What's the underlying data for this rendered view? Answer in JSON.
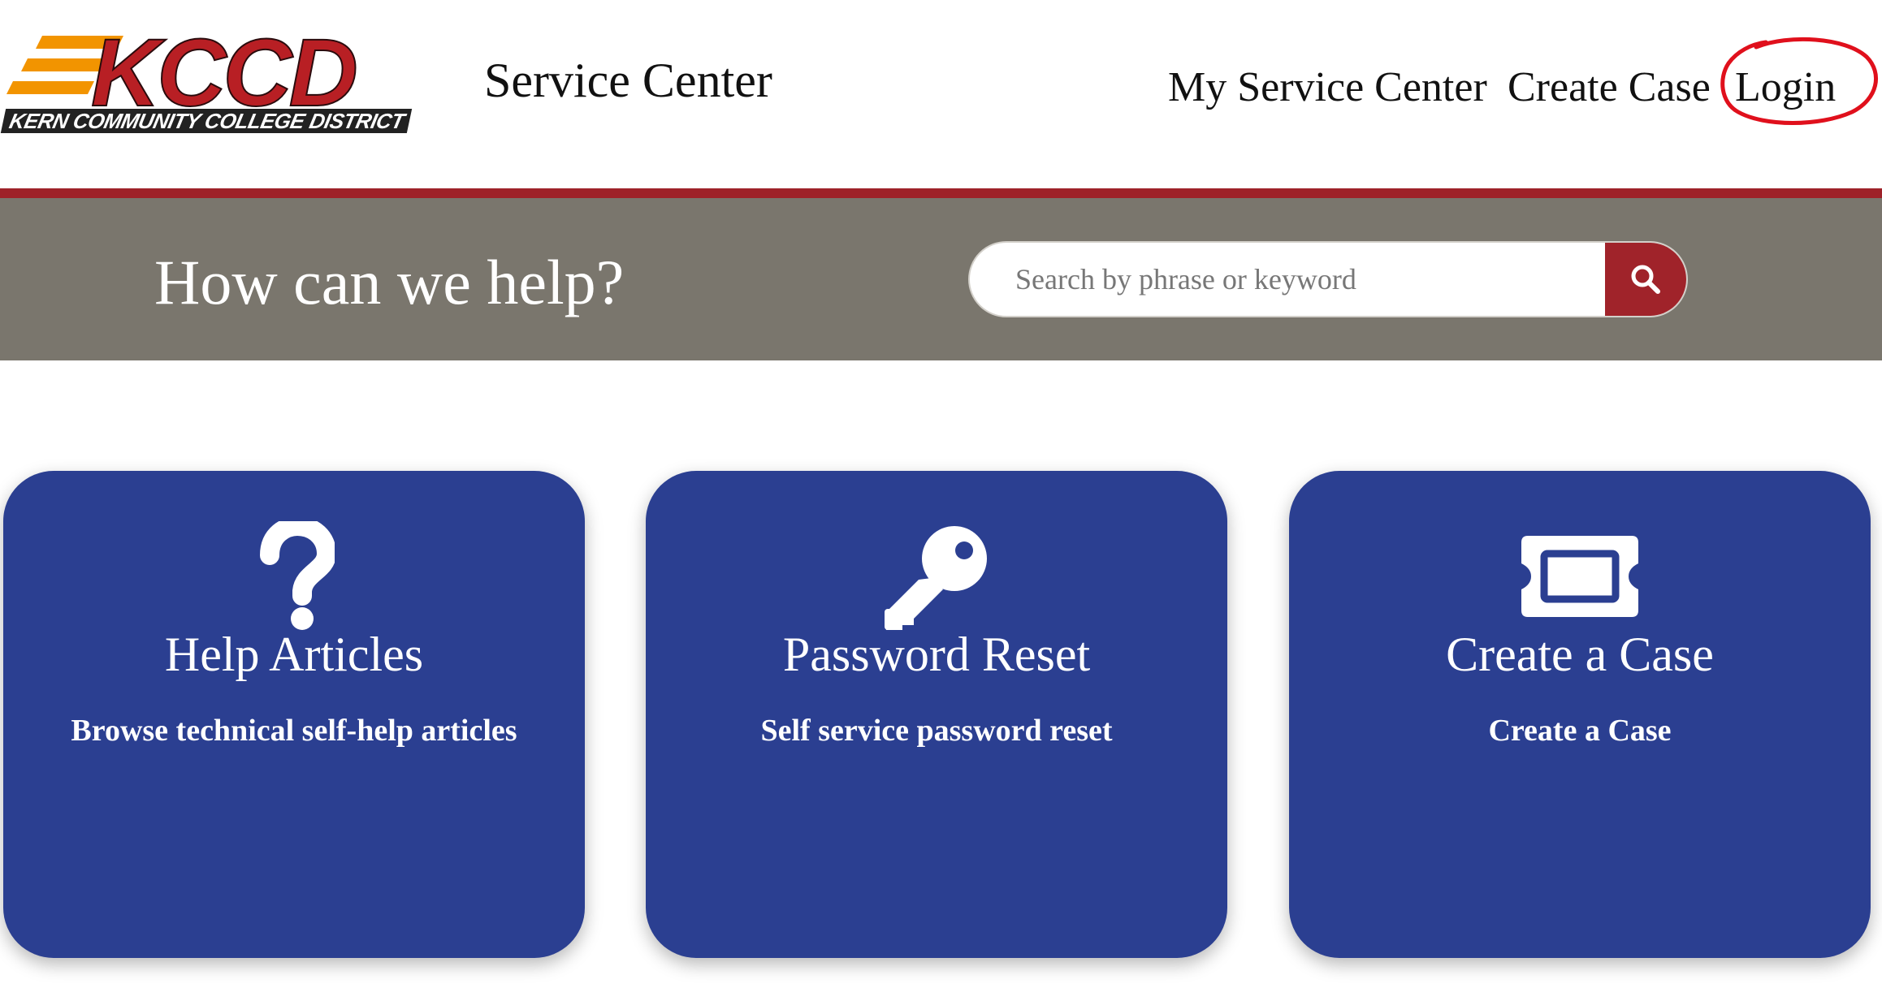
{
  "header": {
    "logo_text": "KCCD",
    "logo_caption": "KERN COMMUNITY COLLEGE DISTRICT",
    "site_title": "Service Center",
    "nav": [
      {
        "label": "My Service Center"
      },
      {
        "label": "Create Case"
      },
      {
        "label": "Login"
      }
    ]
  },
  "hero": {
    "title": "How can we help?",
    "search": {
      "placeholder": "Search by phrase or keyword",
      "value": ""
    }
  },
  "cards": [
    {
      "icon": "question-mark-icon",
      "title": "Help Articles",
      "description": "Browse technical self-help articles"
    },
    {
      "icon": "key-icon",
      "title": "Password Reset",
      "description": "Self service password reset"
    },
    {
      "icon": "ticket-icon",
      "title": "Create a Case",
      "description": "Create a Case"
    }
  ],
  "colors": {
    "brand_red": "#9e2229",
    "hero_gray": "#7a766d",
    "card_blue": "#2b3f91",
    "logo_orange": "#f29400",
    "logo_red": "#b81f24",
    "annotation_red": "#e0101c"
  }
}
